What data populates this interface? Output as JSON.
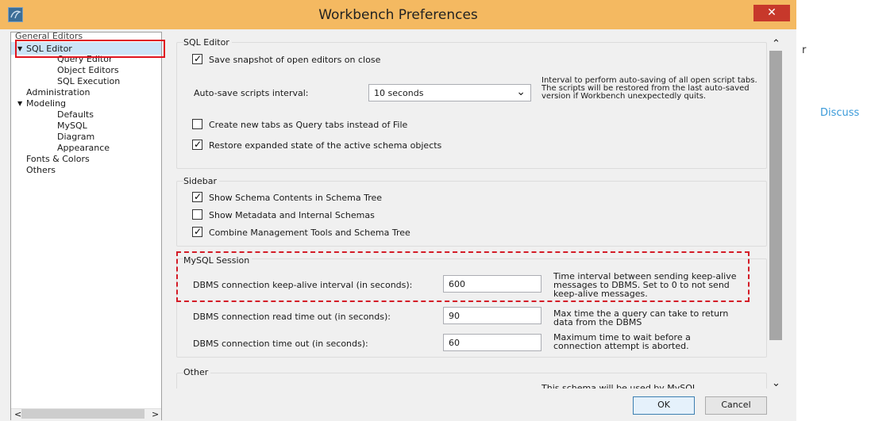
{
  "window": {
    "title": "Workbench Preferences",
    "close_symbol": "✕"
  },
  "tree": {
    "items": [
      {
        "label": "General Editors"
      },
      {
        "label": "SQL Editor"
      },
      {
        "label": "Query Editor"
      },
      {
        "label": "Object Editors"
      },
      {
        "label": "SQL Execution"
      },
      {
        "label": "Administration"
      },
      {
        "label": "Modeling"
      },
      {
        "label": "Defaults"
      },
      {
        "label": "MySQL"
      },
      {
        "label": "Diagram"
      },
      {
        "label": "Appearance"
      },
      {
        "label": "Fonts & Colors"
      },
      {
        "label": "Others"
      }
    ],
    "expand_symbol": "▼",
    "scroll_left": "<",
    "scroll_right": ">"
  },
  "sql_editor": {
    "title": "SQL Editor",
    "save_snapshot": {
      "label": "Save snapshot of open editors on close",
      "checked": true
    },
    "autosave": {
      "label": "Auto-save scripts interval:",
      "value": "10 seconds",
      "note": "Interval to perform auto-saving of all open script tabs. The scripts will be restored from the last auto-saved version if Workbench unexpectedly quits."
    },
    "query_tabs": {
      "label": "Create new tabs as Query tabs instead of File",
      "checked": false
    },
    "restore_state": {
      "label": "Restore expanded state of the active schema objects",
      "checked": true
    }
  },
  "sidebar": {
    "title": "Sidebar",
    "show_schema_contents": {
      "label": "Show Schema Contents in Schema Tree",
      "checked": true
    },
    "show_metadata": {
      "label": "Show Metadata and Internal Schemas",
      "checked": false
    },
    "combine_tools": {
      "label": "Combine Management Tools and Schema Tree",
      "checked": true
    }
  },
  "mysql_session": {
    "title": "MySQL Session",
    "keepalive": {
      "label": "DBMS connection keep-alive interval (in seconds):",
      "value": "600",
      "note": "Time interval between sending keep-alive messages to DBMS. Set to 0 to not send keep-alive messages."
    },
    "read_timeout": {
      "label": "DBMS connection read time out (in seconds):",
      "value": "90",
      "note": "Max time the a query can take to return data from the DBMS"
    },
    "conn_timeout": {
      "label": "DBMS connection time out (in seconds):",
      "value": "60",
      "note": "Maximum time to wait before a connection attempt is aborted."
    }
  },
  "other": {
    "title": "Other",
    "note": "This schema will be used by MySQL"
  },
  "buttons": {
    "ok": "OK",
    "cancel": "Cancel"
  },
  "background": {
    "discuss_link": "Discuss",
    "stray_text": "r"
  },
  "scroll": {
    "up": "⌃",
    "down": "⌄"
  },
  "check_symbol": "✓",
  "dropdown_symbol": "⌄",
  "colors": {
    "titlebar": "#f4b961",
    "close": "#c7382b",
    "highlight": "#e0151f",
    "link": "#3a9ad9",
    "selection": "#cce4f7"
  }
}
